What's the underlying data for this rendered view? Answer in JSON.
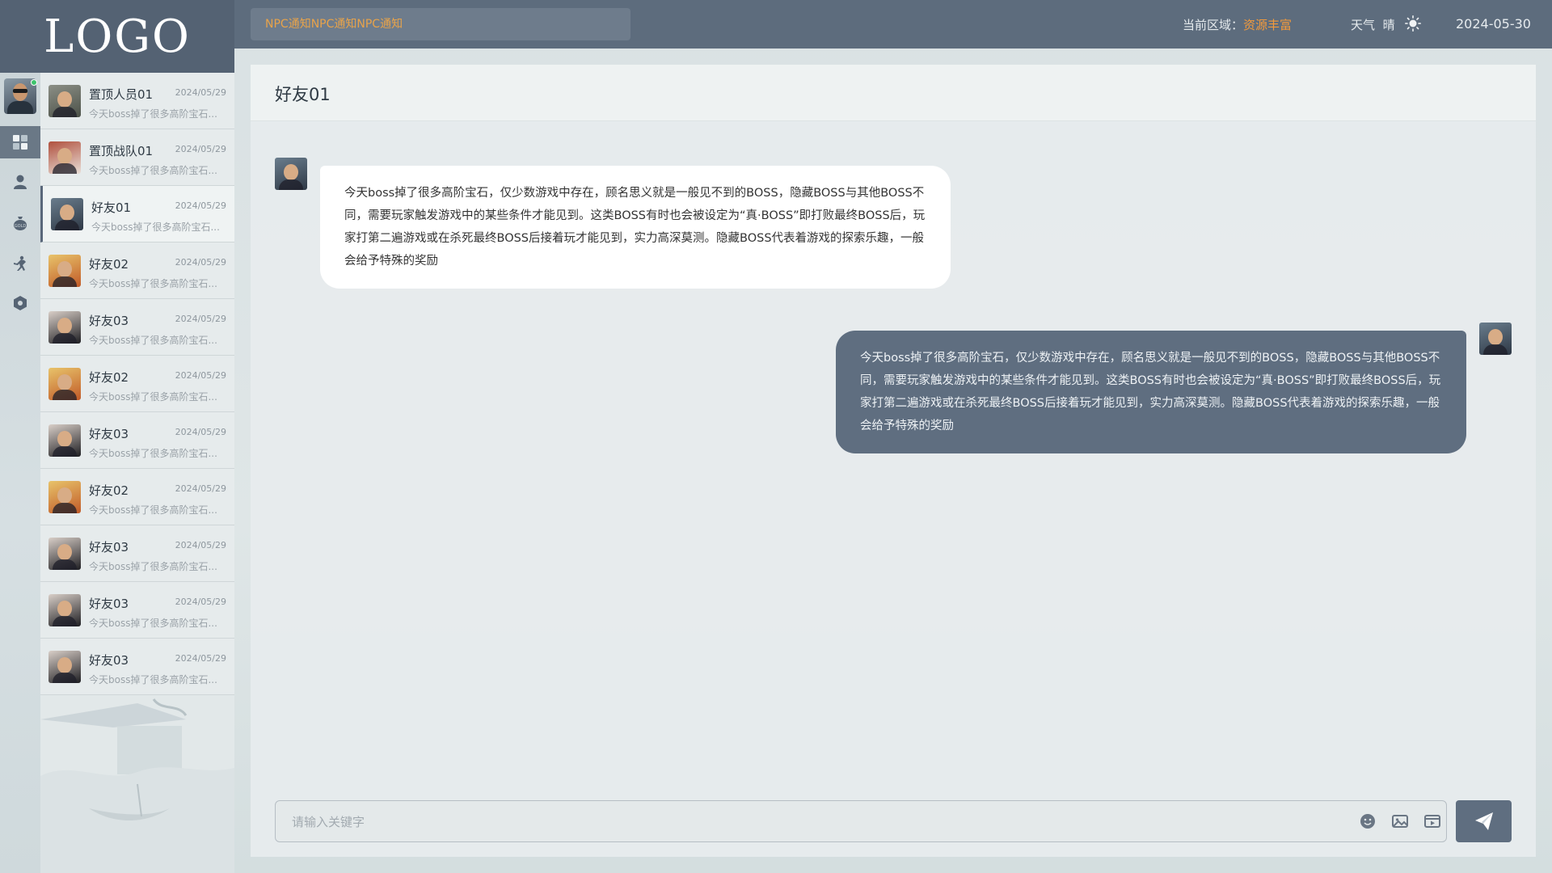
{
  "logo": "LOGO",
  "rail": {
    "items": [
      {
        "icon": "dashboard-icon",
        "glyph": "▦"
      },
      {
        "icon": "user-icon",
        "glyph": "👤"
      },
      {
        "icon": "money-bag-icon",
        "glyph": "💰"
      },
      {
        "icon": "fighter-icon",
        "glyph": "⚔"
      },
      {
        "icon": "settings-hex-icon",
        "glyph": "⬢"
      }
    ]
  },
  "topbar": {
    "notice": "NPC通知NPC通知NPC通知",
    "region_label": "当前区域：",
    "region_value": "资源丰富",
    "weather_label": "天气",
    "weather_value": "晴",
    "date": "2024-05-30"
  },
  "chatlist": {
    "items": [
      {
        "name": "置顶人员01",
        "date": "2024/05/29",
        "preview": "今天boss掉了很多高阶宝石..."
      },
      {
        "name": "置顶战队01",
        "date": "2024/05/29",
        "preview": "今天boss掉了很多高阶宝石..."
      },
      {
        "name": "好友01",
        "date": "2024/05/29",
        "preview": "今天boss掉了很多高阶宝石..."
      },
      {
        "name": "好友02",
        "date": "2024/05/29",
        "preview": "今天boss掉了很多高阶宝石..."
      },
      {
        "name": "好友03",
        "date": "2024/05/29",
        "preview": "今天boss掉了很多高阶宝石..."
      },
      {
        "name": "好友02",
        "date": "2024/05/29",
        "preview": "今天boss掉了很多高阶宝石..."
      },
      {
        "name": "好友03",
        "date": "2024/05/29",
        "preview": "今天boss掉了很多高阶宝石..."
      },
      {
        "name": "好友02",
        "date": "2024/05/29",
        "preview": "今天boss掉了很多高阶宝石..."
      },
      {
        "name": "好友03",
        "date": "2024/05/29",
        "preview": "今天boss掉了很多高阶宝石..."
      },
      {
        "name": "好友03",
        "date": "2024/05/29",
        "preview": "今天boss掉了很多高阶宝石..."
      },
      {
        "name": "好友03",
        "date": "2024/05/29",
        "preview": "今天boss掉了很多高阶宝石..."
      }
    ]
  },
  "chat": {
    "title": "好友01",
    "messages": [
      {
        "from": "friend",
        "text": "今天boss掉了很多高阶宝石，仅少数游戏中存在，顾名思义就是一般见不到的BOSS，隐藏BOSS与其他BOSS不同，需要玩家触发游戏中的某些条件才能见到。这类BOSS有时也会被设定为“真·BOSS”即打败最终BOSS后，玩家打第二遍游戏或在杀死最终BOSS后接着玩才能见到，实力高深莫测。隐藏BOSS代表着游戏的探索乐趣，一般会给予特殊的奖励"
      },
      {
        "from": "me",
        "text": "今天boss掉了很多高阶宝石，仅少数游戏中存在，顾名思义就是一般见不到的BOSS，隐藏BOSS与其他BOSS不同，需要玩家触发游戏中的某些条件才能见到。这类BOSS有时也会被设定为“真·BOSS”即打败最终BOSS后，玩家打第二遍游戏或在杀死最终BOSS后接着玩才能见到，实力高深莫测。隐藏BOSS代表着游戏的探索乐趣，一般会给予特殊的奖励"
      }
    ],
    "input_placeholder": "请输入关键字",
    "input_value": ""
  },
  "colors": {
    "topbar": "#5d6c7d",
    "accent_orange": "#f29a3c",
    "bubble_me": "#5f6e80",
    "bubble_friend": "#ffffff"
  }
}
